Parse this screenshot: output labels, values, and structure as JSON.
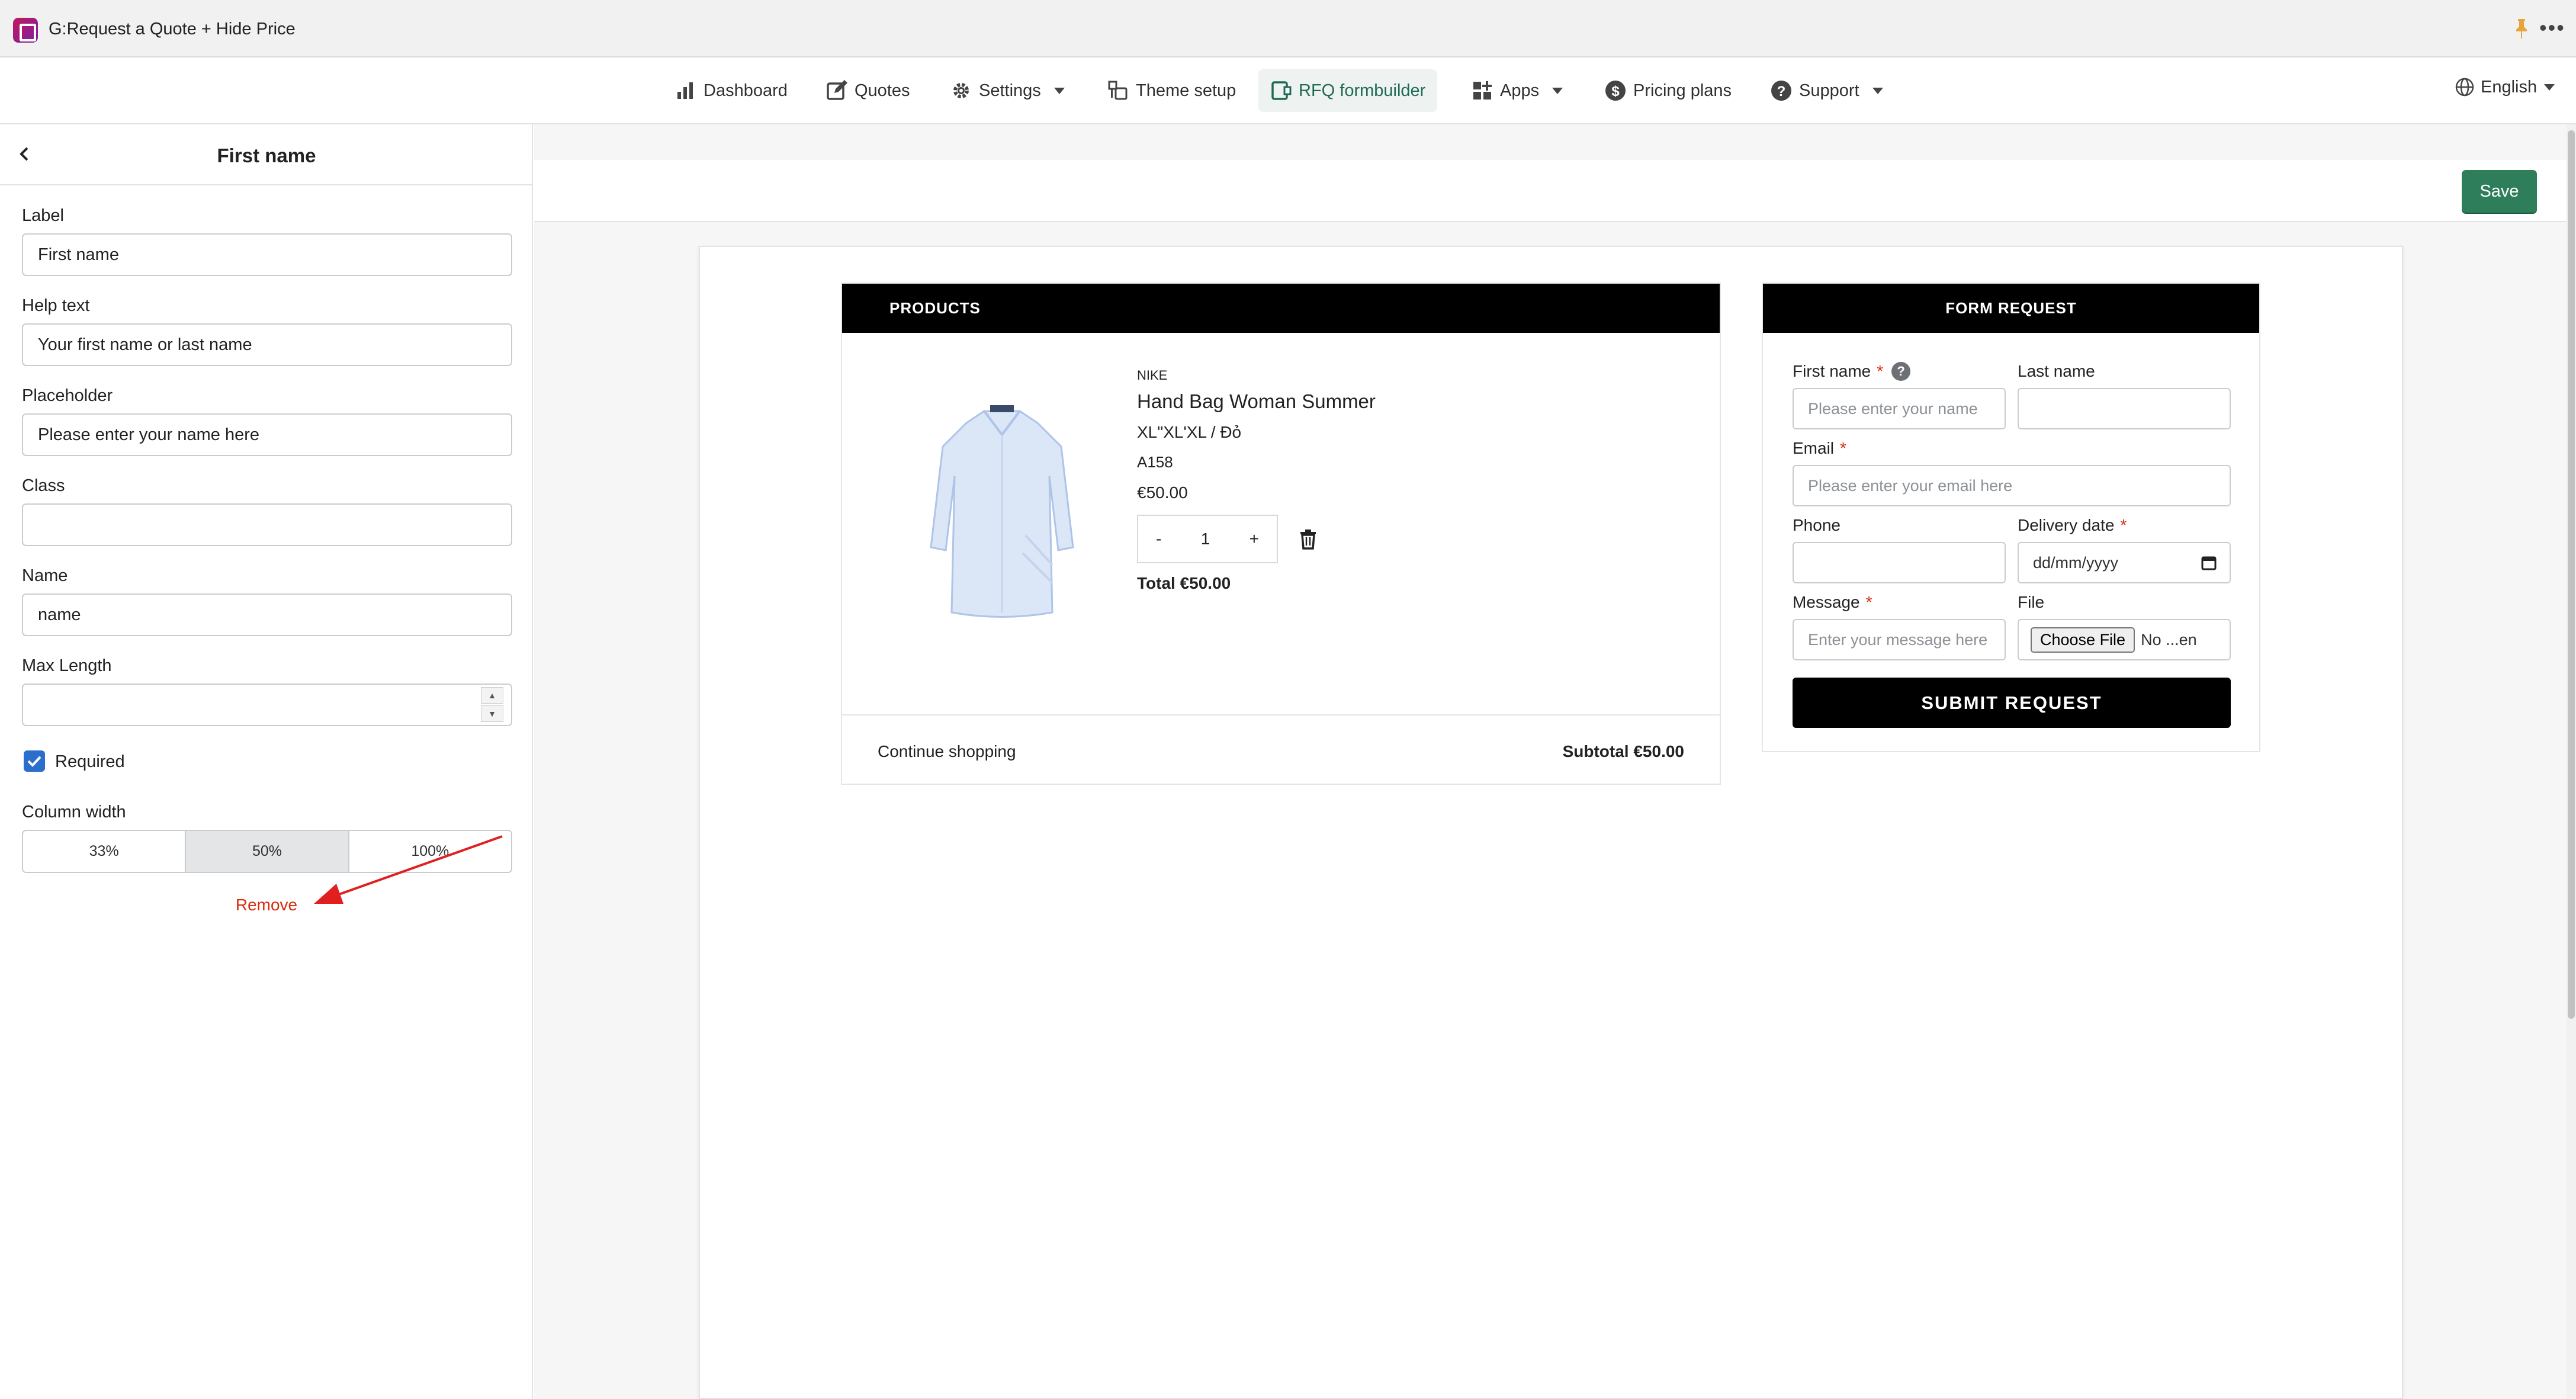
{
  "app": {
    "title": "G:Request a Quote + Hide Price"
  },
  "nav": {
    "items": [
      {
        "label": "Dashboard",
        "icon": "bar-chart-icon"
      },
      {
        "label": "Quotes",
        "icon": "edit-icon"
      },
      {
        "label": "Settings",
        "icon": "gear-icon"
      },
      {
        "label": "Theme setup",
        "icon": "theme-icon"
      },
      {
        "label": "RFQ formbuilder",
        "icon": "formbuilder-icon"
      },
      {
        "label": "Apps",
        "icon": "apps-icon"
      },
      {
        "label": "Pricing plans",
        "icon": "dollar-icon"
      },
      {
        "label": "Support",
        "icon": "help-icon"
      }
    ],
    "language": "English"
  },
  "sidebar": {
    "title": "First name",
    "label_caption": "Label",
    "label_value": "First name",
    "help_caption": "Help text",
    "help_value": "Your first name or last name",
    "placeholder_caption": "Placeholder",
    "placeholder_value": "Please enter your name here",
    "class_caption": "Class",
    "class_value": "",
    "name_caption": "Name",
    "name_value": "name",
    "maxlength_caption": "Max Length",
    "maxlength_value": "",
    "required_label": "Required",
    "column_width_caption": "Column width",
    "widths": [
      "33%",
      "50%",
      "100%"
    ],
    "selected_width": "50%",
    "remove_label": "Remove"
  },
  "toolbar": {
    "save_label": "Save"
  },
  "products": {
    "header": "PRODUCTS",
    "brand": "NIKE",
    "name": "Hand Bag Woman Summer",
    "variant": "XL\"XL'XL / Đỏ",
    "sku": "A158",
    "price": "€50.00",
    "qty_minus": "-",
    "qty": "1",
    "qty_plus": "+",
    "total": "Total €50.00",
    "continue": "Continue shopping",
    "subtotal": "Subtotal €50.00"
  },
  "form": {
    "header": "FORM REQUEST",
    "first_name_label": "First name",
    "first_name_placeholder": "Please enter your name",
    "last_name_label": "Last name",
    "email_label": "Email",
    "email_placeholder": "Please enter your email here",
    "phone_label": "Phone",
    "delivery_label": "Delivery date",
    "delivery_value": "dd/mm/yyyy",
    "message_label": "Message",
    "message_placeholder": "Enter your message here",
    "file_label": "File",
    "choose_file": "Choose File",
    "file_status": "No ...en",
    "submit": "SUBMIT REQUEST",
    "required_mark": "*",
    "help_mark": "?"
  },
  "colors": {
    "accent": "#2e7d5b",
    "danger": "#d82c0d",
    "checkbox": "#2c6ecb"
  }
}
